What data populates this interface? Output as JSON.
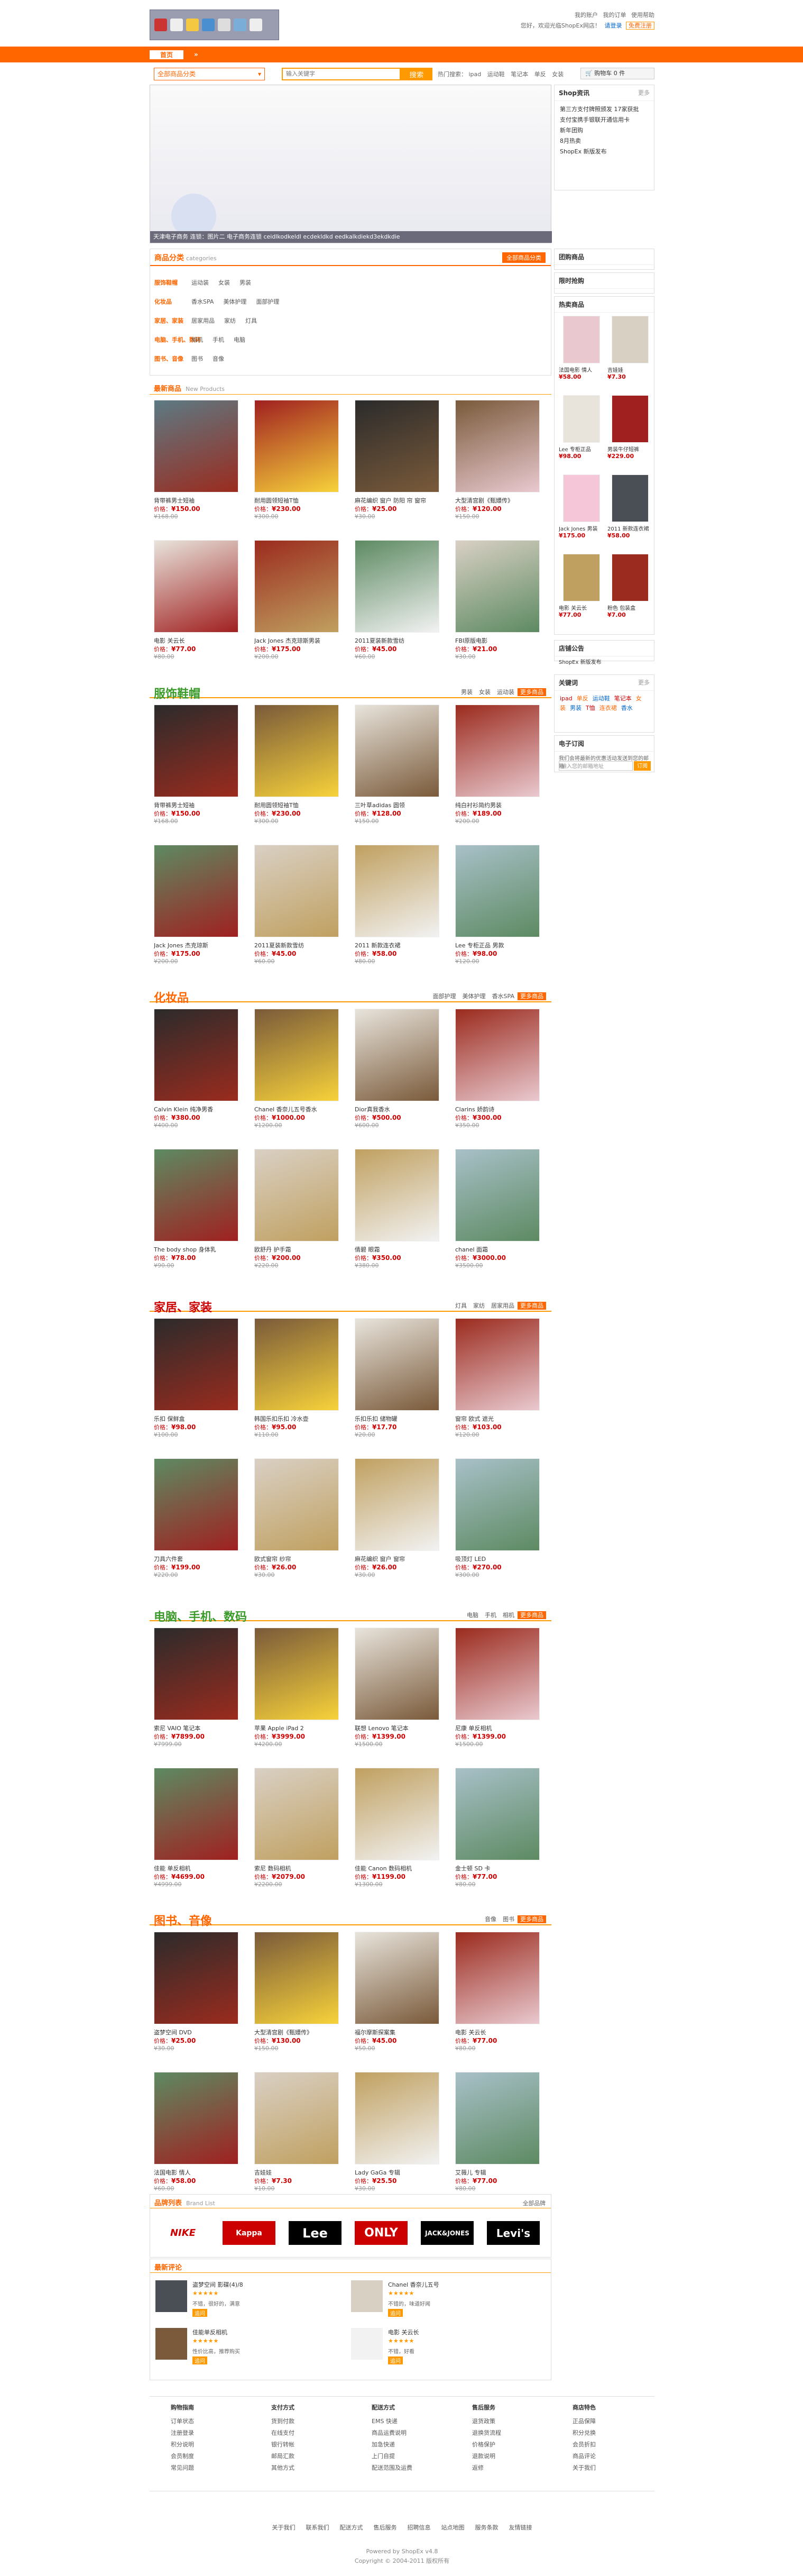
{
  "top": {
    "links": [
      "我的账户",
      "我的订单",
      "使用帮助"
    ],
    "welcome": "您好，欢迎光临ShopEx网店！",
    "login": "请登录",
    "register": "免费注册"
  },
  "nav": {
    "items": [
      "首页",
      "»"
    ]
  },
  "search": {
    "category_label": "全部商品分类",
    "placeholder": "输入关键字",
    "button": "搜索",
    "hot_label": "热门搜索：",
    "hot_words": [
      "ipad",
      "运动鞋",
      "笔记本",
      "单反",
      "女装"
    ],
    "cart_label": "购物车 0 件"
  },
  "banner": {
    "caption": "天津电子商务   连锁：图片二   电子商务连锁   ceidlkodkeldl   ecdekldkd   eedkalkdiekd3ekdkdie"
  },
  "categories": {
    "title": "商品分类",
    "subtitle": "categories",
    "all_button": "全部商品分类",
    "rows": [
      {
        "label": "服饰鞋帽",
        "items": [
          "运动装",
          "女装",
          "男装"
        ]
      },
      {
        "label": "化妆品",
        "items": [
          "香水SPA",
          "美体护理",
          "面部护理"
        ]
      },
      {
        "label": "家居、家装",
        "items": [
          "居家用品",
          "家纺",
          "灯具"
        ]
      },
      {
        "label": "电脑、手机、数码",
        "items": [
          "相机",
          "手机",
          "电脑"
        ]
      },
      {
        "label": "图书、音像",
        "items": [
          "图书",
          "音像"
        ]
      }
    ]
  },
  "new_products": {
    "title": "最新商品",
    "subtitle": "New Products",
    "items": [
      {
        "name": "背带裤男士短袖",
        "price": "¥150.00",
        "old": "¥168.00"
      },
      {
        "name": "耐用圆领短袖T恤",
        "price": "¥230.00",
        "old": "¥300.00"
      },
      {
        "name": "麻花编织 窗户 防阳 帘 窗帘",
        "price": "¥25.00",
        "old": "¥30.00"
      },
      {
        "name": "大型清宫剧《甄嬛传》",
        "price": "¥120.00",
        "old": "¥150.00"
      },
      {
        "name": "电影 关云长",
        "price": "¥77.00",
        "old": "¥80.00"
      },
      {
        "name": "Jack Jones 杰克琼斯男装",
        "price": "¥175.00",
        "old": "¥200.00"
      },
      {
        "name": "2011夏装新款雪纺",
        "price": "¥45.00",
        "old": "¥60.00"
      },
      {
        "name": "FBI原版电影",
        "price": "¥21.00",
        "old": "¥30.00"
      }
    ]
  },
  "sections": [
    {
      "title": "服饰鞋帽",
      "links": [
        "男装",
        "女装",
        "运动装",
        "更多商品"
      ],
      "items": [
        {
          "name": "背带裤男士短袖",
          "price": "¥150.00",
          "old": "¥168.00"
        },
        {
          "name": "耐用圆领短袖T恤",
          "price": "¥230.00",
          "old": "¥300.00"
        },
        {
          "name": "三叶草adidas 圆领",
          "price": "¥128.00",
          "old": "¥150.00"
        },
        {
          "name": "纯白衬衫简约男装",
          "price": "¥189.00",
          "old": "¥200.00"
        },
        {
          "name": "Jack Jones 杰克琼斯",
          "price": "¥175.00",
          "old": "¥200.00"
        },
        {
          "name": "2011夏装新款雪纺",
          "price": "¥45.00",
          "old": "¥60.00"
        },
        {
          "name": "2011 新款连衣裙",
          "price": "¥58.00",
          "old": "¥80.00"
        },
        {
          "name": "Lee 专柜正品 男款",
          "price": "¥98.00",
          "old": "¥120.00"
        }
      ]
    },
    {
      "title": "化妆品",
      "links": [
        "面部护理",
        "美体护理",
        "香水SPA",
        "更多商品"
      ],
      "items": [
        {
          "name": "Calvin Klein 纯净男香",
          "price": "¥380.00",
          "old": "¥400.00"
        },
        {
          "name": "Chanel 香奈儿五号香水",
          "price": "¥1000.00",
          "old": "¥1200.00"
        },
        {
          "name": "Dior真我香水",
          "price": "¥500.00",
          "old": "¥600.00"
        },
        {
          "name": "Clarins 娇韵诗",
          "price": "¥300.00",
          "old": "¥350.00"
        },
        {
          "name": "The body shop 身体乳",
          "price": "¥78.00",
          "old": "¥90.00"
        },
        {
          "name": "欧舒丹 护手霜",
          "price": "¥200.00",
          "old": "¥220.00"
        },
        {
          "name": "倩碧 眼霜",
          "price": "¥350.00",
          "old": "¥380.00"
        },
        {
          "name": "chanel 面霜",
          "price": "¥3000.00",
          "old": "¥3500.00"
        }
      ]
    },
    {
      "title": "家居、家装",
      "links": [
        "灯具",
        "家纺",
        "居家用品",
        "更多商品"
      ],
      "items": [
        {
          "name": "乐扣 保鲜盒",
          "price": "¥98.00",
          "old": "¥100.00"
        },
        {
          "name": "韩国乐扣乐扣 冷水壶",
          "price": "¥95.00",
          "old": "¥110.00"
        },
        {
          "name": "乐扣乐扣 储物罐",
          "price": "¥17.70",
          "old": "¥20.00"
        },
        {
          "name": "窗帘 欧式 遮光",
          "price": "¥103.00",
          "old": "¥120.00"
        },
        {
          "name": "刀具六件套",
          "price": "¥199.00",
          "old": "¥220.00"
        },
        {
          "name": "欧式窗帘 纱帘",
          "price": "¥26.00",
          "old": "¥30.00"
        },
        {
          "name": "麻花编织 窗户 窗帘",
          "price": "¥26.00",
          "old": "¥30.00"
        },
        {
          "name": "吸顶灯 LED",
          "price": "¥270.00",
          "old": "¥300.00"
        }
      ]
    },
    {
      "title": "电脑、手机、数码",
      "links": [
        "电脑",
        "手机",
        "相机",
        "更多商品"
      ],
      "items": [
        {
          "name": "索尼 VAIO 笔记本",
          "price": "¥7899.00",
          "old": "¥7999.00"
        },
        {
          "name": "苹果 Apple iPad 2",
          "price": "¥3999.00",
          "old": "¥4200.00"
        },
        {
          "name": "联想 Lenovo 笔记本",
          "price": "¥1399.00",
          "old": "¥1500.00"
        },
        {
          "name": "尼康 单反相机",
          "price": "¥1399.00",
          "old": "¥1500.00"
        },
        {
          "name": "佳能 单反相机",
          "price": "¥4699.00",
          "old": "¥4999.00"
        },
        {
          "name": "索尼 数码相机",
          "price": "¥2079.00",
          "old": "¥2200.00"
        },
        {
          "name": "佳能 Canon 数码相机",
          "price": "¥1199.00",
          "old": "¥1300.00"
        },
        {
          "name": "金士顿 SD 卡",
          "price": "¥77.00",
          "old": "¥80.00"
        }
      ]
    },
    {
      "title": "图书、音像",
      "links": [
        "音像",
        "图书",
        "更多商品"
      ],
      "items": [
        {
          "name": "盗梦空间 DVD",
          "price": "¥25.00",
          "old": "¥30.00"
        },
        {
          "name": "大型清宫剧《甄嬛传》",
          "price": "¥130.00",
          "old": "¥150.00"
        },
        {
          "name": "福尔摩斯探案集",
          "price": "¥45.00",
          "old": "¥50.00"
        },
        {
          "name": "电影 关云长",
          "price": "¥77.00",
          "old": "¥80.00"
        },
        {
          "name": "法国电影 情人",
          "price": "¥58.00",
          "old": "¥60.00"
        },
        {
          "name": "吉娃娃",
          "price": "¥7.30",
          "old": "¥10.00"
        },
        {
          "name": "Lady GaGa 专辑",
          "price": "¥25.50",
          "old": "¥30.00"
        },
        {
          "name": "艾薇儿 专辑",
          "price": "¥77.00",
          "old": "¥80.00"
        }
      ]
    }
  ],
  "brands": {
    "title": "品牌列表",
    "subtitle": "Brand List",
    "more": "全部品牌",
    "items": [
      "NIKE",
      "Kappa",
      "Lee",
      "ONLY",
      "JACK&JONES",
      "Levi's"
    ]
  },
  "reviews": {
    "title": "最新评论",
    "items": [
      {
        "product": "盗梦空间 影碟(4)/8",
        "text": "不错，很好的，满意",
        "reply": "追问"
      },
      {
        "product": "Chanel 香奈儿五号",
        "text": "不错的，味道好闻",
        "reply": "追问"
      },
      {
        "product": "佳能单反相机",
        "text": "性价比高，推荐购买",
        "reply": "追问"
      },
      {
        "product": "电影 关云长",
        "text": "不错，好看",
        "reply": "追问"
      }
    ]
  },
  "sidebar": {
    "news": {
      "title": "Shop资讯",
      "more": "更多",
      "items": [
        "第三方支付牌照颁发 17家获批",
        "支付宝携手银联开通信用卡",
        "新年团购",
        "8月热卖",
        "ShopEx 新版发布"
      ]
    },
    "hot": {
      "title": "团购商品"
    },
    "seckill": {
      "title": "限时抢购"
    },
    "rank": {
      "title": "热卖商品",
      "items": [
        {
          "name": "法国电影 情人",
          "price": "¥58.00"
        },
        {
          "name": "吉娃娃",
          "price": "¥7.30"
        },
        {
          "name": "Lee 专柜正品",
          "price": "¥98.00"
        },
        {
          "name": "男装牛仔短裤",
          "price": "¥229.00"
        },
        {
          "name": "Jack Jones 男装",
          "price": "¥175.00"
        },
        {
          "name": "2011 新款连衣裙",
          "price": "¥58.00"
        },
        {
          "name": "电影 关云长",
          "price": "¥77.00"
        },
        {
          "name": "粉色 包装盒",
          "price": "¥7.00"
        }
      ]
    },
    "notice": {
      "title": "店铺公告",
      "items": [
        "ShopEx 新版发布"
      ]
    },
    "tags": {
      "title": "关键词",
      "more": "更多",
      "items": [
        "ipad",
        "单反",
        "运动鞋",
        "笔记本",
        "女装",
        "男装",
        "T恤",
        "连衣裙",
        "香水"
      ]
    },
    "subscribe": {
      "title": "电子订阅",
      "text": "我们会将最新的优惠活动发送到您的邮箱",
      "placeholder": "输入您的邮箱地址",
      "button": "订阅"
    }
  },
  "footer": {
    "cols": [
      {
        "title": "购物指南",
        "items": [
          "订单状态",
          "注册登录",
          "积分说明",
          "会员制度",
          "常见问题"
        ]
      },
      {
        "title": "支付方式",
        "items": [
          "货到付款",
          "在线支付",
          "银行转帐",
          "邮局汇款",
          "其他方式"
        ]
      },
      {
        "title": "配送方式",
        "items": [
          "EMS 快递",
          "商品运费说明",
          "加急快递",
          "上门自提",
          "配送范围及运费"
        ]
      },
      {
        "title": "售后服务",
        "items": [
          "退货政策",
          "退换货流程",
          "价格保护",
          "退款说明",
          "返修"
        ]
      },
      {
        "title": "商店特色",
        "items": [
          "正品保障",
          "积分兑换",
          "会员折扣",
          "商品评论",
          "关于我们"
        ]
      }
    ],
    "links": [
      "关于我们",
      "联系我们",
      "配送方式",
      "售后服务",
      "招聘信息",
      "站点地图",
      "服务条款",
      "友情链接"
    ],
    "powered": "Powered by ShopEx v4.8",
    "copyright": "Copyright © 2004-2011 版权所有"
  }
}
